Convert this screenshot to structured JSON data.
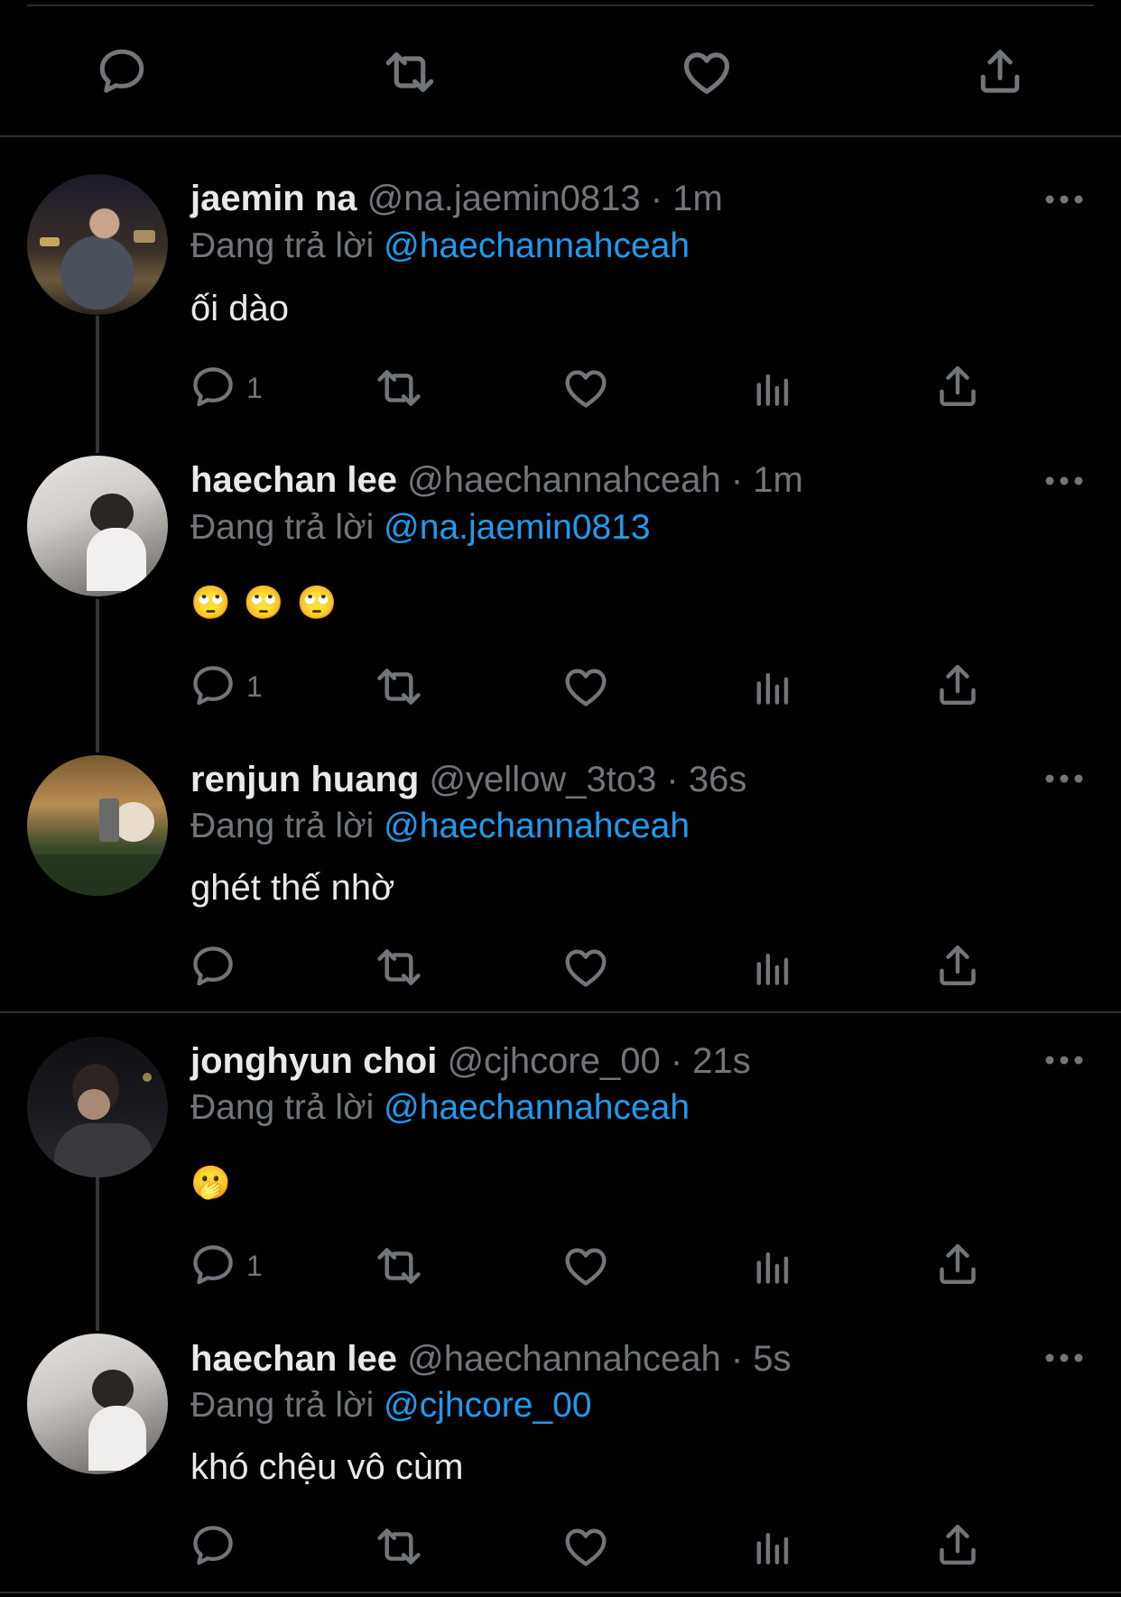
{
  "top_bar": {
    "actions": [
      "reply",
      "retweet",
      "like",
      "share"
    ]
  },
  "tweets": [
    {
      "name": "jaemin na",
      "handle": "@na.jaemin0813",
      "time": "1m",
      "reply_label": "Đang trả lời",
      "reply_to": "@haechannahceah",
      "text": "ối dào",
      "reply_count": "1"
    },
    {
      "name": "haechan lee",
      "handle": "@haechannahceah",
      "time": "1m",
      "reply_label": "Đang trả lời",
      "reply_to": "@na.jaemin0813",
      "text": "🙄🙄🙄",
      "reply_count": "1"
    },
    {
      "name": "renjun huang",
      "handle": "@yellow_3to3",
      "time": "36s",
      "reply_label": "Đang trả lời",
      "reply_to": "@haechannahceah",
      "text": "ghét thế nhờ",
      "reply_count": ""
    },
    {
      "name": "jonghyun choi",
      "handle": "@cjhcore_00",
      "time": "21s",
      "reply_label": "Đang trả lời",
      "reply_to": "@haechannahceah",
      "text": "🫢",
      "reply_count": "1"
    },
    {
      "name": "haechan lee",
      "handle": "@haechannahceah",
      "time": "5s",
      "reply_label": "Đang trả lời",
      "reply_to": "@cjhcore_00",
      "text": "khó chệu vô cùm",
      "reply_count": ""
    }
  ],
  "colors": {
    "background": "#000000",
    "mention": "#1d9bf0",
    "secondary": "#71767b",
    "divider": "#2f3336"
  },
  "icons": [
    "reply-icon",
    "retweet-icon",
    "like-icon",
    "views-icon",
    "share-icon",
    "more-icon"
  ]
}
